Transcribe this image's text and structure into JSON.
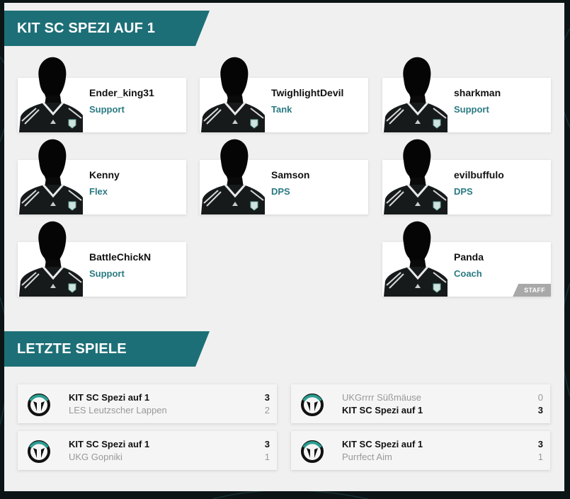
{
  "sections": {
    "team_title": "KIT SC SPEZI AUF 1",
    "games_title": "LETZTE SPIELE"
  },
  "players": [
    {
      "name": "Ender_king31",
      "role": "Support"
    },
    {
      "name": "TwighlightDevil",
      "role": "Tank"
    },
    {
      "name": "sharkman",
      "role": "Support"
    },
    {
      "name": "Kenny",
      "role": "Flex"
    },
    {
      "name": "Samson",
      "role": "DPS"
    },
    {
      "name": "evilbuffulo",
      "role": "DPS"
    },
    {
      "name": "BattleChickN",
      "role": "Support"
    },
    {
      "name": "Panda",
      "role": "Coach",
      "badge": "STAFF"
    }
  ],
  "matches": [
    {
      "team1": "KIT SC Spezi auf 1",
      "score1": "3",
      "team2": "LES Leutzscher Lappen",
      "score2": "2",
      "winner": 1
    },
    {
      "team1": "UKGrrrr Süßmäuse",
      "score1": "0",
      "team2": "KIT SC Spezi auf 1",
      "score2": "3",
      "winner": 2
    },
    {
      "team1": "KIT SC Spezi auf 1",
      "score1": "3",
      "team2": "UKG Gopniki",
      "score2": "1",
      "winner": 1
    },
    {
      "team1": "KIT SC Spezi auf 1",
      "score1": "3",
      "team2": "Purrfect Aim",
      "score2": "1",
      "winner": 1
    }
  ],
  "colors": {
    "accent": "#1d6f77",
    "role_text": "#2a7a82",
    "ow_ring": "#2a9d8f"
  }
}
